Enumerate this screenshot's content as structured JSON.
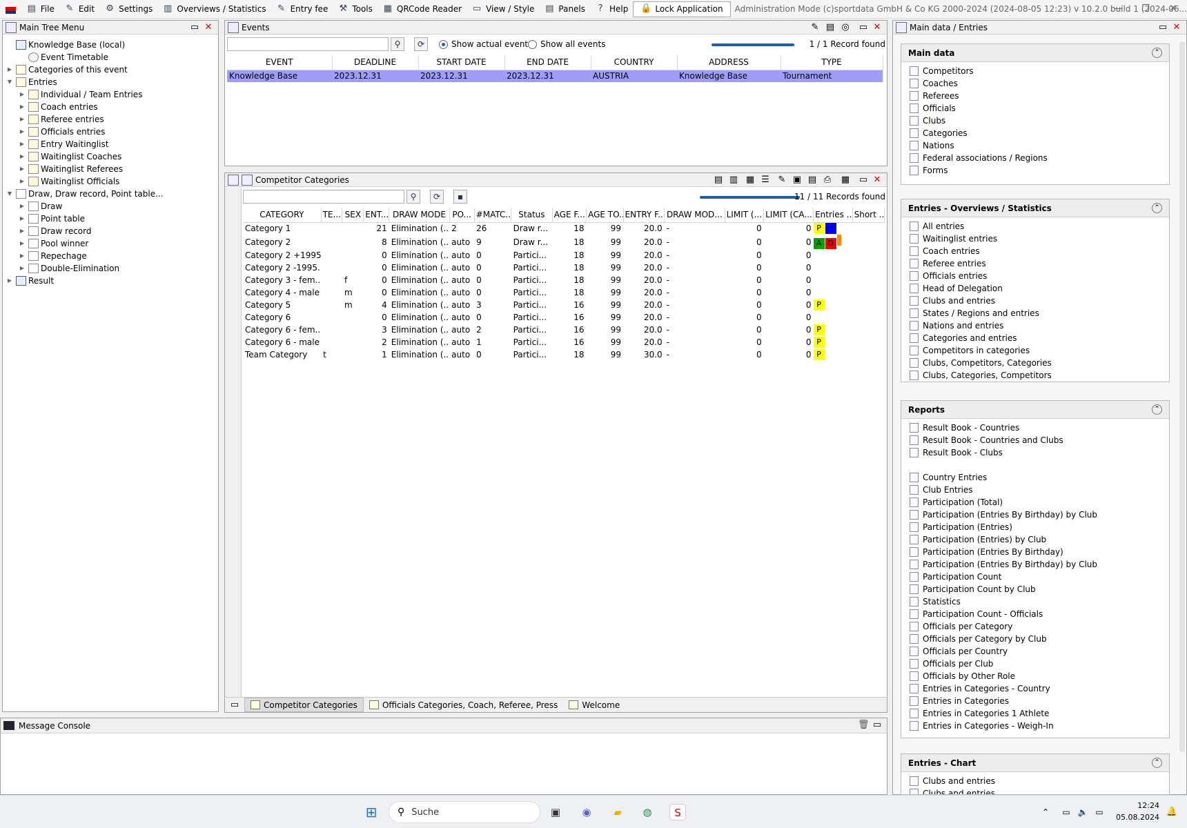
{
  "menu": {
    "items": [
      "File",
      "Edit",
      "Settings",
      "Overviews / Statistics",
      "Entry fee",
      "Tools",
      "QRCode Reader",
      "View / Style",
      "Panels",
      "Help"
    ],
    "lock": "Lock Application",
    "admin": "Administration Mode (c)sportdata GmbH & Co KG 2000-2024 (2024-08-05 12:23)  v 10.2.0 build 1 (2024-06..."
  },
  "tree": {
    "title": "Main Tree Menu",
    "items": [
      {
        "label": "Knowledge Base (local)",
        "level": 0,
        "toggle": "",
        "icon": "db"
      },
      {
        "label": "Event Timetable",
        "level": 1,
        "toggle": "",
        "icon": "clk"
      },
      {
        "label": "Categories of this event",
        "level": 0,
        "toggle": "▶",
        "icon": "fld"
      },
      {
        "label": "Entries",
        "level": 0,
        "toggle": "▼",
        "icon": "fld"
      },
      {
        "label": "Individual / Team Entries",
        "level": 1,
        "toggle": "▶",
        "icon": "fld"
      },
      {
        "label": "Coach entries",
        "level": 1,
        "toggle": "▶",
        "icon": "fld"
      },
      {
        "label": "Referee entries",
        "level": 1,
        "toggle": "▶",
        "icon": "fld"
      },
      {
        "label": "Officials entries",
        "level": 1,
        "toggle": "▶",
        "icon": "fld"
      },
      {
        "label": "Entry Waitinglist",
        "level": 1,
        "toggle": "▶",
        "icon": "fld"
      },
      {
        "label": "Waitinglist Coaches",
        "level": 1,
        "toggle": "▶",
        "icon": "fld"
      },
      {
        "label": "Waitinglist Referees",
        "level": 1,
        "toggle": "▶",
        "icon": "fld"
      },
      {
        "label": "Waitinglist Officials",
        "level": 1,
        "toggle": "▶",
        "icon": "fld"
      },
      {
        "label": "Draw, Draw record, Point table...",
        "level": 0,
        "toggle": "▼",
        "icon": "grid"
      },
      {
        "label": "Draw",
        "level": 1,
        "toggle": "▶",
        "icon": "grid"
      },
      {
        "label": "Point table",
        "level": 1,
        "toggle": "▶",
        "icon": "grid"
      },
      {
        "label": "Draw record",
        "level": 1,
        "toggle": "▶",
        "icon": "grid"
      },
      {
        "label": "Pool winner",
        "level": 1,
        "toggle": "▶",
        "icon": "grid"
      },
      {
        "label": "Repechage",
        "level": 1,
        "toggle": "▶",
        "icon": "grid"
      },
      {
        "label": "Double-Elimination",
        "level": 1,
        "toggle": "▶",
        "icon": "grid"
      },
      {
        "label": "Result",
        "level": 0,
        "toggle": "▶",
        "icon": "db"
      }
    ]
  },
  "events": {
    "title": "Events",
    "show_actual": "Show actual events",
    "show_all": "Show all events",
    "records": "1 / 1 Record found",
    "columns": [
      "EVENT",
      "DEADLINE",
      "START DATE",
      "END DATE",
      "COUNTRY",
      "ADDRESS",
      "TYPE"
    ],
    "rows": [
      [
        "Knowledge Base",
        "2023.12.31",
        "2023.12.31",
        "2023.12.31",
        "AUSTRIA",
        "Knowledge Base",
        "Tournament"
      ]
    ]
  },
  "categories": {
    "title": "Competitor Categories",
    "records": "11 / 11 Records found",
    "columns": [
      "CATEGORY",
      "TE...",
      "SEX",
      "ENT...",
      "DRAW MODE",
      "PO...",
      "#MATC...",
      "Status",
      "AGE F...",
      "AGE TO...",
      "ENTRY F...",
      "DRAW MOD...",
      "LIMIT (...",
      "LIMIT (CA...",
      "Entries ...",
      "Short ..."
    ],
    "rows": [
      [
        "Category 1",
        "",
        "",
        "21",
        "Elimination (...",
        "2",
        "26",
        "Draw r...",
        "18",
        "99",
        "20.0",
        "-",
        "0",
        "0"
      ],
      [
        "Category 2",
        "",
        "",
        "8",
        "Elimination (...",
        "auto",
        "9",
        "Draw r...",
        "18",
        "99",
        "20.0",
        "-",
        "0",
        "0"
      ],
      [
        "Category 2 +1995...",
        "",
        "",
        "0",
        "Elimination (...",
        "auto",
        "0",
        "Partici...",
        "18",
        "99",
        "20.0",
        "-",
        "0",
        "0"
      ],
      [
        "Category 2 -1995...",
        "",
        "",
        "0",
        "Elimination (...",
        "auto",
        "0",
        "Partici...",
        "18",
        "99",
        "20.0",
        "-",
        "0",
        "0"
      ],
      [
        "Category 3 - fem...",
        "",
        "f",
        "0",
        "Elimination (...",
        "auto",
        "0",
        "Partici...",
        "18",
        "99",
        "20.0",
        "-",
        "0",
        "0"
      ],
      [
        "Category 4 - male",
        "",
        "m",
        "0",
        "Elimination (...",
        "auto",
        "0",
        "Partici...",
        "18",
        "99",
        "20.0",
        "-",
        "0",
        "0"
      ],
      [
        "Category 5",
        "",
        "m",
        "4",
        "Elimination (...",
        "auto",
        "3",
        "Partici...",
        "16",
        "99",
        "20.0",
        "-",
        "0",
        "0"
      ],
      [
        "Category 6",
        "",
        "",
        "0",
        "Elimination (...",
        "auto",
        "0",
        "Partici...",
        "16",
        "99",
        "20.0",
        "-",
        "0",
        "0"
      ],
      [
        "Category 6 - fem...",
        "",
        "",
        "3",
        "Elimination (...",
        "auto",
        "2",
        "Partici...",
        "16",
        "99",
        "20.0",
        "-",
        "0",
        "0"
      ],
      [
        "Category 6 - male",
        "",
        "",
        "2",
        "Elimination (...",
        "auto",
        "1",
        "Partici...",
        "16",
        "99",
        "20.0",
        "-",
        "0",
        "0"
      ],
      [
        "Team Category",
        "t",
        "",
        "1",
        "Elimination (...",
        "auto",
        "0",
        "Partici...",
        "18",
        "99",
        "30.0",
        "-",
        "0",
        "0"
      ]
    ],
    "badges": [
      [
        {
          "t": "P",
          "c": "#ffff00",
          "f": "#000"
        },
        {
          "t": "W",
          "c": "#0000ee",
          "f": "#0000ee"
        }
      ],
      [
        {
          "t": "A",
          "c": "#00a000",
          "f": "#000"
        },
        {
          "t": "D",
          "c": "#ee0000",
          "f": "#000"
        },
        {
          "t": "",
          "c": "#ff8800",
          "f": "#000"
        }
      ],
      [],
      [],
      [],
      [],
      [
        {
          "t": "P",
          "c": "#ffff00",
          "f": "#000"
        }
      ],
      [],
      [
        {
          "t": "P",
          "c": "#ffff00",
          "f": "#000"
        }
      ],
      [
        {
          "t": "P",
          "c": "#ffff00",
          "f": "#000"
        }
      ],
      [
        {
          "t": "P",
          "c": "#ffff00",
          "f": "#000"
        }
      ]
    ],
    "tabs": [
      "Competitor Categories",
      "Officials Categories, Coach, Referee, Press",
      "Welcome"
    ]
  },
  "console": {
    "title": "Message Console"
  },
  "right": {
    "title": "Main data / Entries",
    "sections": [
      {
        "title": "Main data",
        "items": [
          "Competitors",
          "Coaches",
          "Referees",
          "Officials",
          "Clubs",
          "Categories",
          "Nations",
          "Federal associations / Regions",
          "Forms"
        ]
      },
      {
        "title": "Entries - Overviews / Statistics",
        "items": [
          "All entries",
          "Waitinglist entries",
          "Coach entries",
          "Referee entries",
          "Officials entries",
          "Head of Delegation",
          "Clubs and entries",
          "States / Regions and entries",
          "Nations and entries",
          "Categories and entries",
          "Competitors in categories",
          "Clubs, Competitors, Categories",
          "Clubs, Categories, Competitors"
        ]
      },
      {
        "title": "Reports",
        "items": [
          "Result Book - Countries",
          "Result Book - Countries and Clubs",
          "Result Book - Clubs",
          "",
          "Country Entries",
          "Club Entries",
          "Participation (Total)",
          "Participation (Entries By Birthday) by Club",
          "Participation (Entries)",
          "Participation (Entries) by Club",
          "Participation (Entries By Birthday)",
          "Participation (Entries By Birthday) by Club",
          "Participation Count",
          "Participation Count by Club",
          "Statistics",
          "Participation Count - Officials",
          "Officials per Category",
          "Officials per Category by Club",
          "Officials per Country",
          "Officials per Club",
          "Officials by Other Role",
          "Entries in Categories - Country",
          "Entries in Categories",
          "Entries in Categories 1 Athlete",
          "Entries in Categories - Weigh-In"
        ]
      },
      {
        "title": "Entries - Chart",
        "items": [
          "Clubs and entries",
          "Clubs and entries"
        ]
      }
    ]
  },
  "taskbar": {
    "search": "Suche",
    "time": "12:24",
    "date": "05.08.2024"
  }
}
